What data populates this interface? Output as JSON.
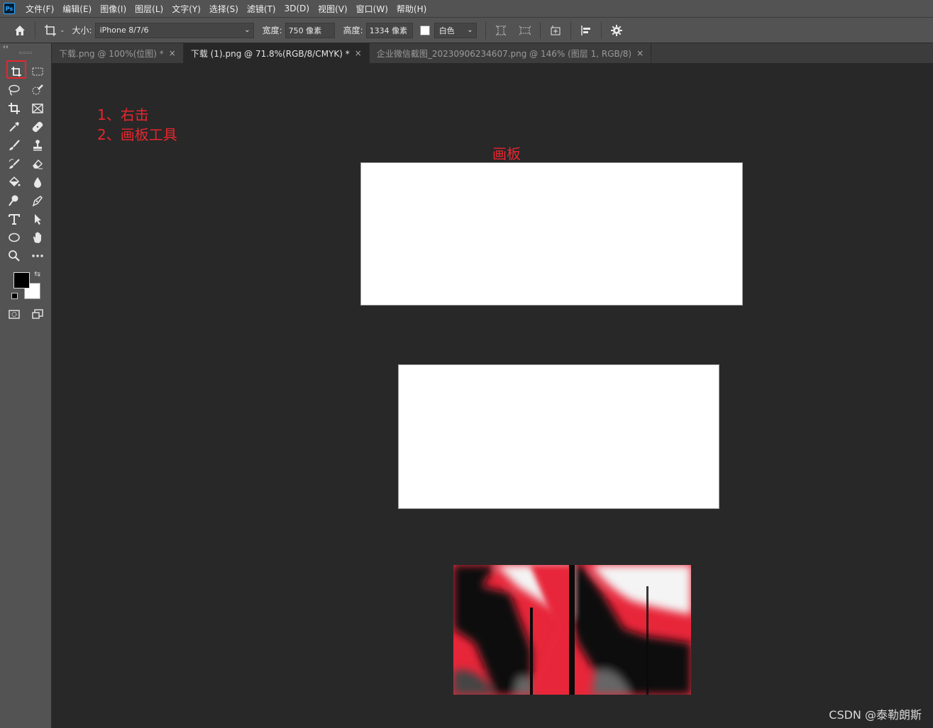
{
  "app": {
    "logo": "Ps"
  },
  "menu": [
    "文件(F)",
    "编辑(E)",
    "图像(I)",
    "图层(L)",
    "文字(Y)",
    "选择(S)",
    "滤镜(T)",
    "3D(D)",
    "视图(V)",
    "窗口(W)",
    "帮助(H)"
  ],
  "options": {
    "size_label": "大小:",
    "size_value": "iPhone 8/7/6",
    "width_label": "宽度:",
    "width_value": "750 像素",
    "height_label": "高度:",
    "height_value": "1334 像素",
    "color_value": "白色"
  },
  "tabs": [
    {
      "label": "下载.png @ 100%(位图) *",
      "active": false
    },
    {
      "label": "下载 (1).png @ 71.8%(RGB/8/CMYK) *",
      "active": true
    },
    {
      "label": "企业微信截图_20230906234607.png @ 146% (图层 1, RGB/8)",
      "active": false
    }
  ],
  "toolbar": {
    "collapse": "‹‹"
  },
  "canvas": {
    "annotation_line1": "1、右击",
    "annotation_line2": "2、画板工具",
    "artboard_label": "画板",
    "watermark": "CSDN @泰勒朗斯"
  },
  "colors": {
    "accent_red": "#e8262e",
    "foreground": "#000000",
    "background": "#ffffff"
  }
}
